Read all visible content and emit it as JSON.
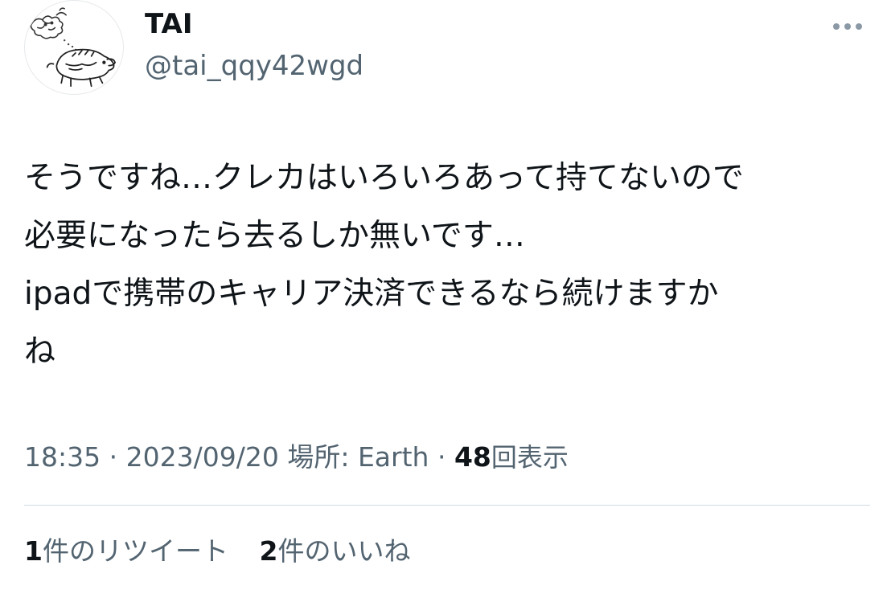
{
  "author": {
    "display_name": "TAI",
    "handle": "@tai_qqy42wgd"
  },
  "more_icon": "more-horizontal-icon",
  "tweet": {
    "text": "そうですね…クレカはいろいろあって持てないので\n必要になったら去るしか無いです…\nipadで携帯のキャリア決済できるなら続けますか\nね"
  },
  "meta": {
    "time": "18:35",
    "separator": "·",
    "date": "2023/09/20",
    "location_label": "場所:",
    "location": "Earth",
    "views_count": "48",
    "views_label": "回表示"
  },
  "engagement": {
    "retweets_count": "1",
    "retweets_label": "件のリツイート",
    "likes_count": "2",
    "likes_label": "件のいいね"
  },
  "colors": {
    "text": "#0f1419",
    "secondary": "#536471",
    "divider": "#cfd9de"
  }
}
